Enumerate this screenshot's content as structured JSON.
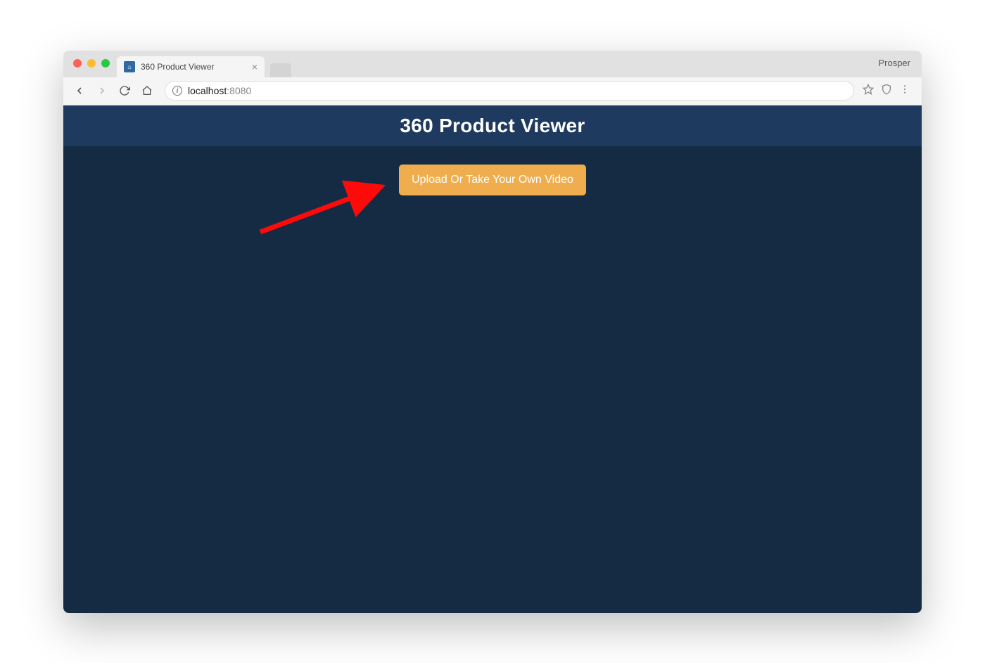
{
  "browser": {
    "traffic_lights": {
      "red": "#ff5f57",
      "yellow": "#febc2e",
      "green": "#28c840"
    },
    "tabs": [
      {
        "title": "360 Product Viewer",
        "favicon_hint": "home-icon"
      }
    ],
    "profile_name": "Prosper",
    "toolbar": {
      "url_host": "localhost",
      "url_port": ":8080"
    }
  },
  "page": {
    "header_title": "360 Product Viewer",
    "upload_button_label": "Upload Or Take Your Own Video"
  },
  "annotation": {
    "type": "arrow",
    "color": "#ff0000"
  },
  "colors": {
    "page_bg": "#152b44",
    "header_bg": "#1e3a5f",
    "button_bg": "#f0ad4e"
  }
}
